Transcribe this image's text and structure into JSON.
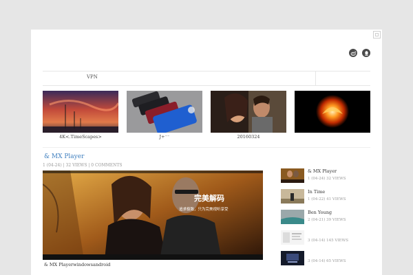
{
  "nav": {
    "items": [
      "VPN"
    ]
  },
  "gallery": [
    {
      "caption": "4K<.TimeScapes>"
    },
    {
      "caption": "J+⁻⁻"
    },
    {
      "caption": "20160324"
    },
    {
      "caption": ""
    }
  ],
  "post": {
    "title": "& MX Player",
    "meta": "1 (04-24) | 32 VIEWS | 0 COMMENTS",
    "image_overlay_title": "完美解码",
    "image_overlay_subtitle": "追求极致，只为完美视听享受",
    "caption": "& MX Playerwindowsandroid"
  },
  "sidebar": [
    {
      "title": "& MX Player",
      "meta": "1 (04-24)    32 VIEWS"
    },
    {
      "title": "In Time",
      "meta": "1 (04-22)    41 VIEWS"
    },
    {
      "title": "Ben Young",
      "meta": "2 (04-21)    39 VIEWS"
    },
    {
      "title": "",
      "meta": "3 (04-14)    145 VIEWS"
    },
    {
      "title": "",
      "meta": "3 (04-14)    65 VIEWS"
    }
  ],
  "icons": {
    "weibo": "weibo-icon",
    "qq": "qq-icon",
    "expand": "expand-icon"
  },
  "colors": {
    "link": "#3f7fbf",
    "background": "#e6e6e6",
    "card": "#ffffff"
  }
}
